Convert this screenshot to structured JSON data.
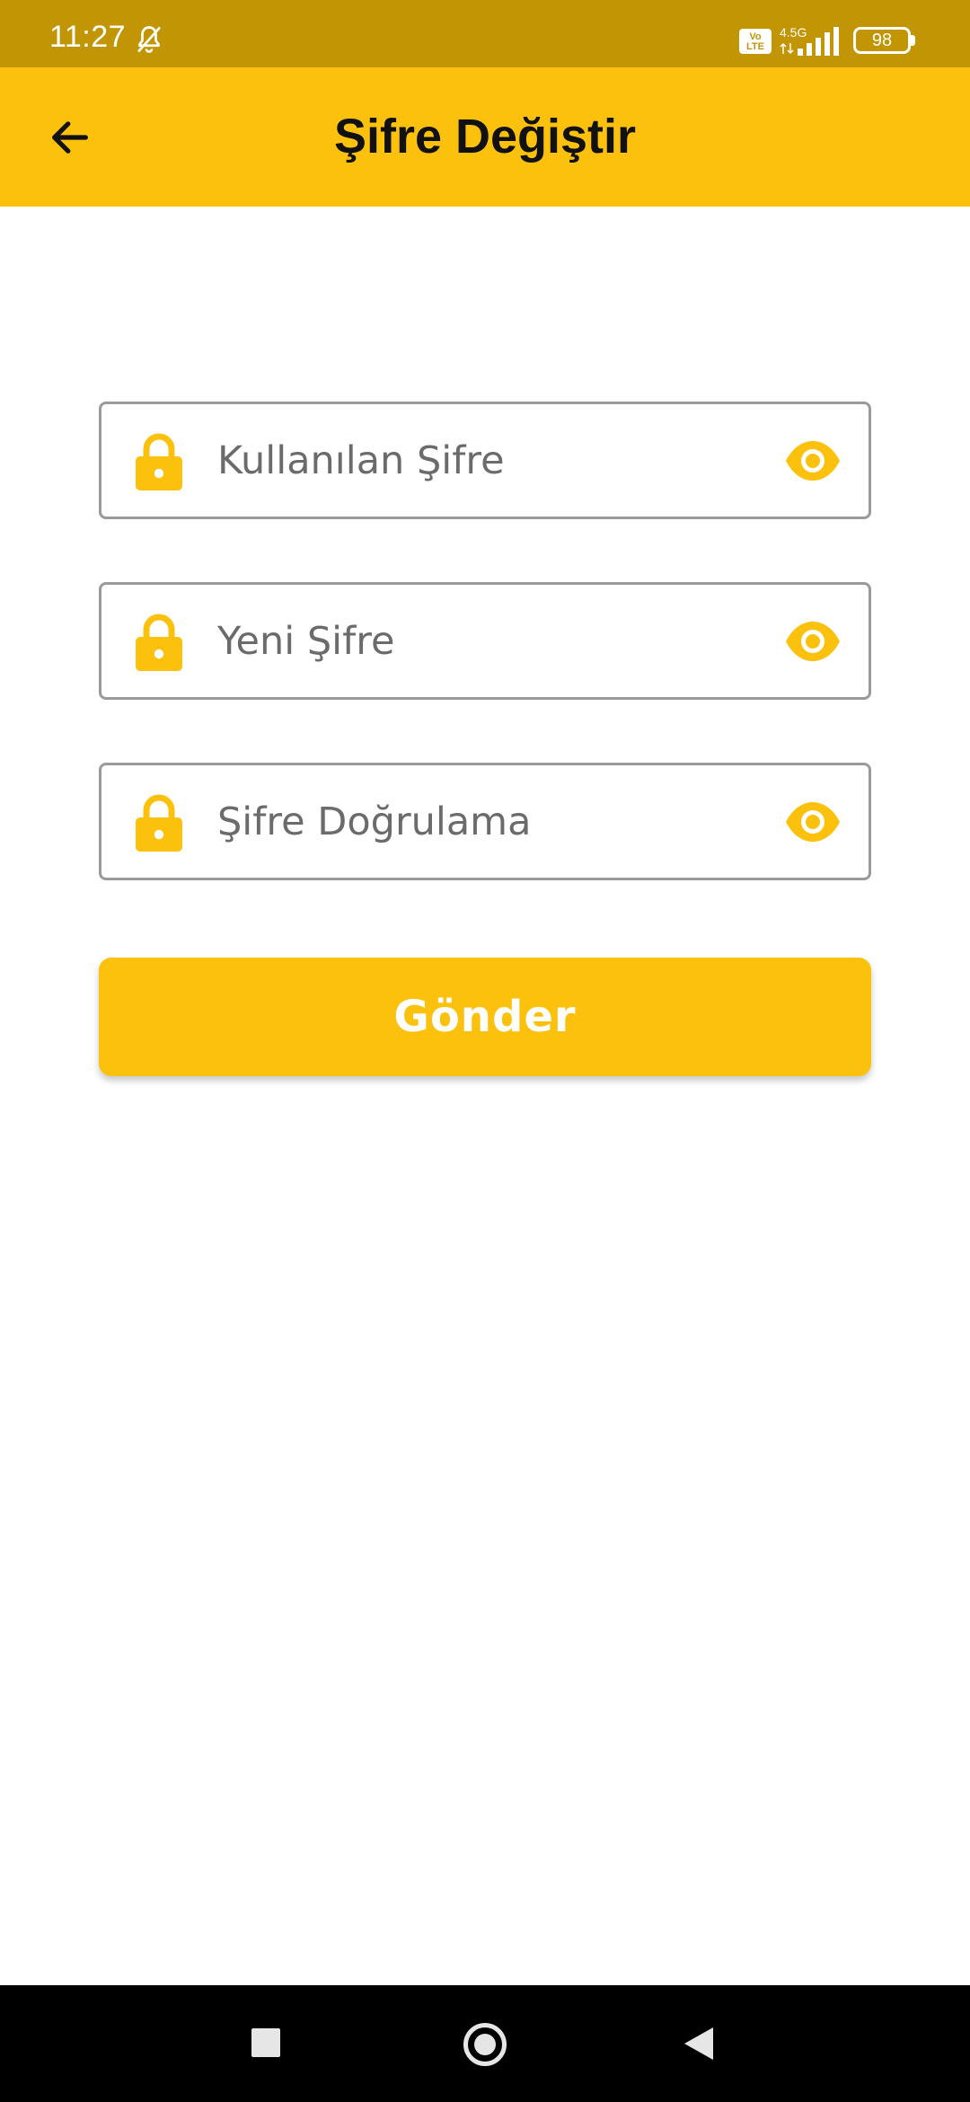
{
  "status_bar": {
    "time": "11:27",
    "network_badge": "Vo LTE",
    "network_type": "4.5G",
    "battery": "98"
  },
  "app_bar": {
    "title": "Şifre Değiştir"
  },
  "form": {
    "fields": [
      {
        "placeholder": "Kullanılan Şifre"
      },
      {
        "placeholder": "Yeni Şifre"
      },
      {
        "placeholder": "Şifre Doğrulama"
      }
    ],
    "submit_label": "Gönder"
  },
  "icons": {
    "field_leading": "lock-icon",
    "field_trailing": "eye-icon",
    "back": "arrow-left-icon"
  },
  "colors": {
    "accent": "#FCC10C",
    "status_bar": "#C19504",
    "field_border": "#9a9a9a",
    "placeholder": "#6b6b6b"
  }
}
